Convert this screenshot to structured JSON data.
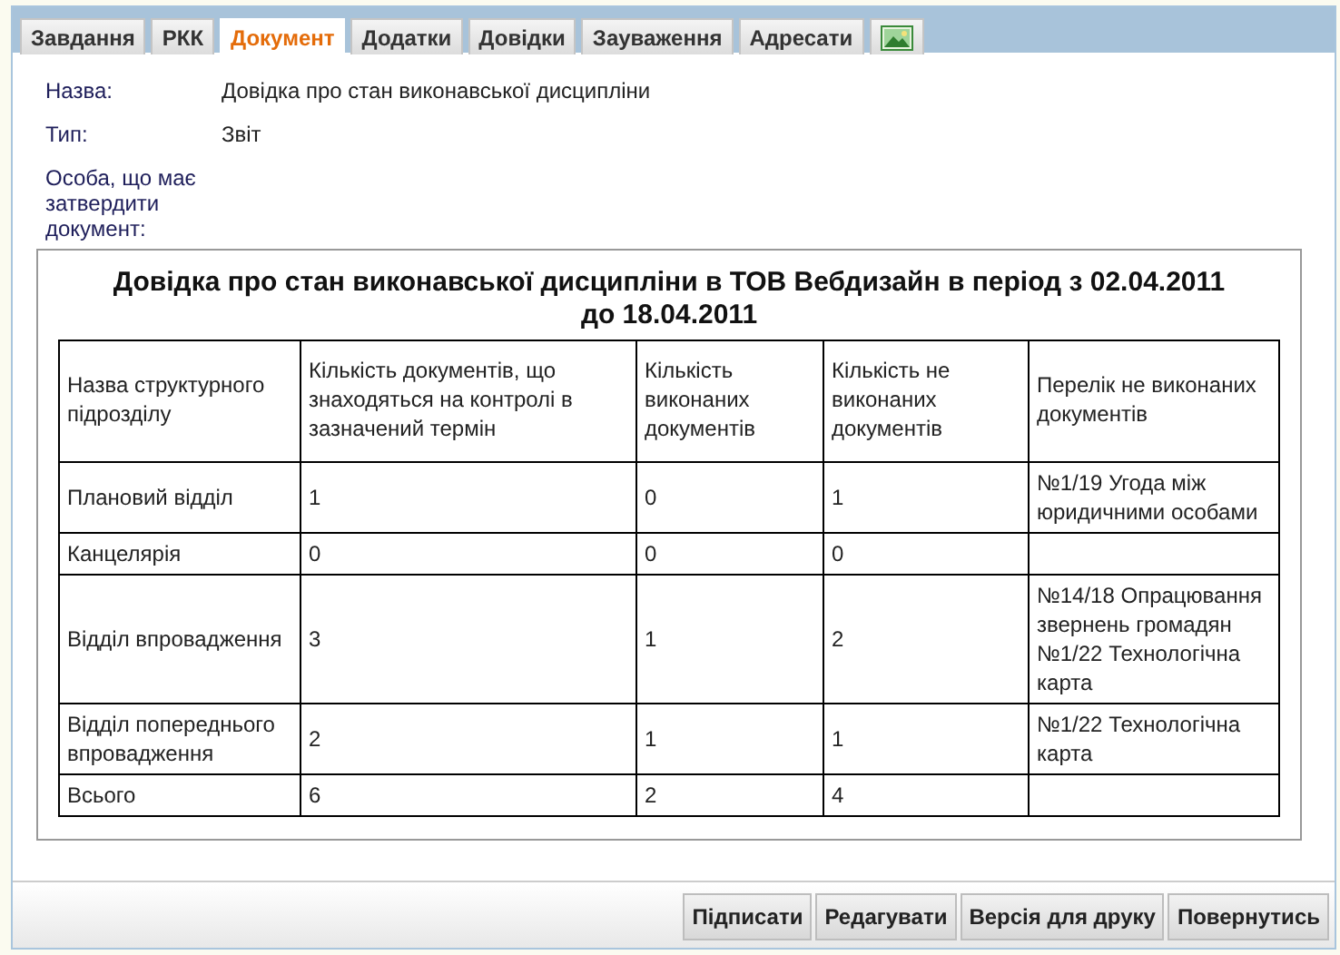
{
  "tabs": [
    {
      "kind": "text",
      "label": "Завдання",
      "selected": false
    },
    {
      "kind": "text",
      "label": "РКК",
      "selected": false
    },
    {
      "kind": "text",
      "label": "Документ",
      "selected": true
    },
    {
      "kind": "text",
      "label": "Додатки",
      "selected": false
    },
    {
      "kind": "text",
      "label": "Довідки",
      "selected": false
    },
    {
      "kind": "text",
      "label": "Зауваження",
      "selected": false
    },
    {
      "kind": "text",
      "label": "Адресати",
      "selected": false
    },
    {
      "kind": "icon",
      "selected": false
    }
  ],
  "fields": [
    {
      "label": "Назва:",
      "value": "Довідка про стан виконавської дисципліни"
    },
    {
      "label": "Тип:",
      "value": "Звіт"
    },
    {
      "label": "Особа, що має затвердити документ:"
    }
  ],
  "report": {
    "title": "Довідка про стан виконавської дисципліни в ТОВ Вебдизайн в період з 02.04.2011 до 18.04.2011",
    "columns": [
      "Назва структурного підрозділу",
      "Кількість документів, що знаходяться на контролі в зазначений термін",
      "Кількість виконаних документів",
      "Кількість не виконаних документів",
      "Перелік не виконаних документів"
    ],
    "rows": [
      {
        "unit": "Плановий відділ",
        "on_control": "1",
        "done": "0",
        "not_done": "1",
        "documents": [
          "№1/19 Угода між юридичними особами"
        ]
      },
      {
        "unit": "Канцелярія",
        "on_control": "0",
        "done": "0",
        "not_done": "0"
      },
      {
        "unit": "Відділ впровадження",
        "on_control": "3",
        "done": "1",
        "not_done": "2",
        "documents": [
          "№14/18 Опрацювання звернень громадян",
          "№1/22 Технологічна карта"
        ]
      },
      {
        "unit": "Відділ попереднього впровадження",
        "on_control": "2",
        "done": "1",
        "not_done": "1",
        "documents": [
          "№1/22 Технологічна карта"
        ]
      },
      {
        "unit": "Всього",
        "on_control": "6",
        "done": "2",
        "not_done": "4"
      }
    ]
  },
  "buttons": [
    "Підписати",
    "Редагувати",
    "Версія для друку",
    "Повернутись"
  ]
}
